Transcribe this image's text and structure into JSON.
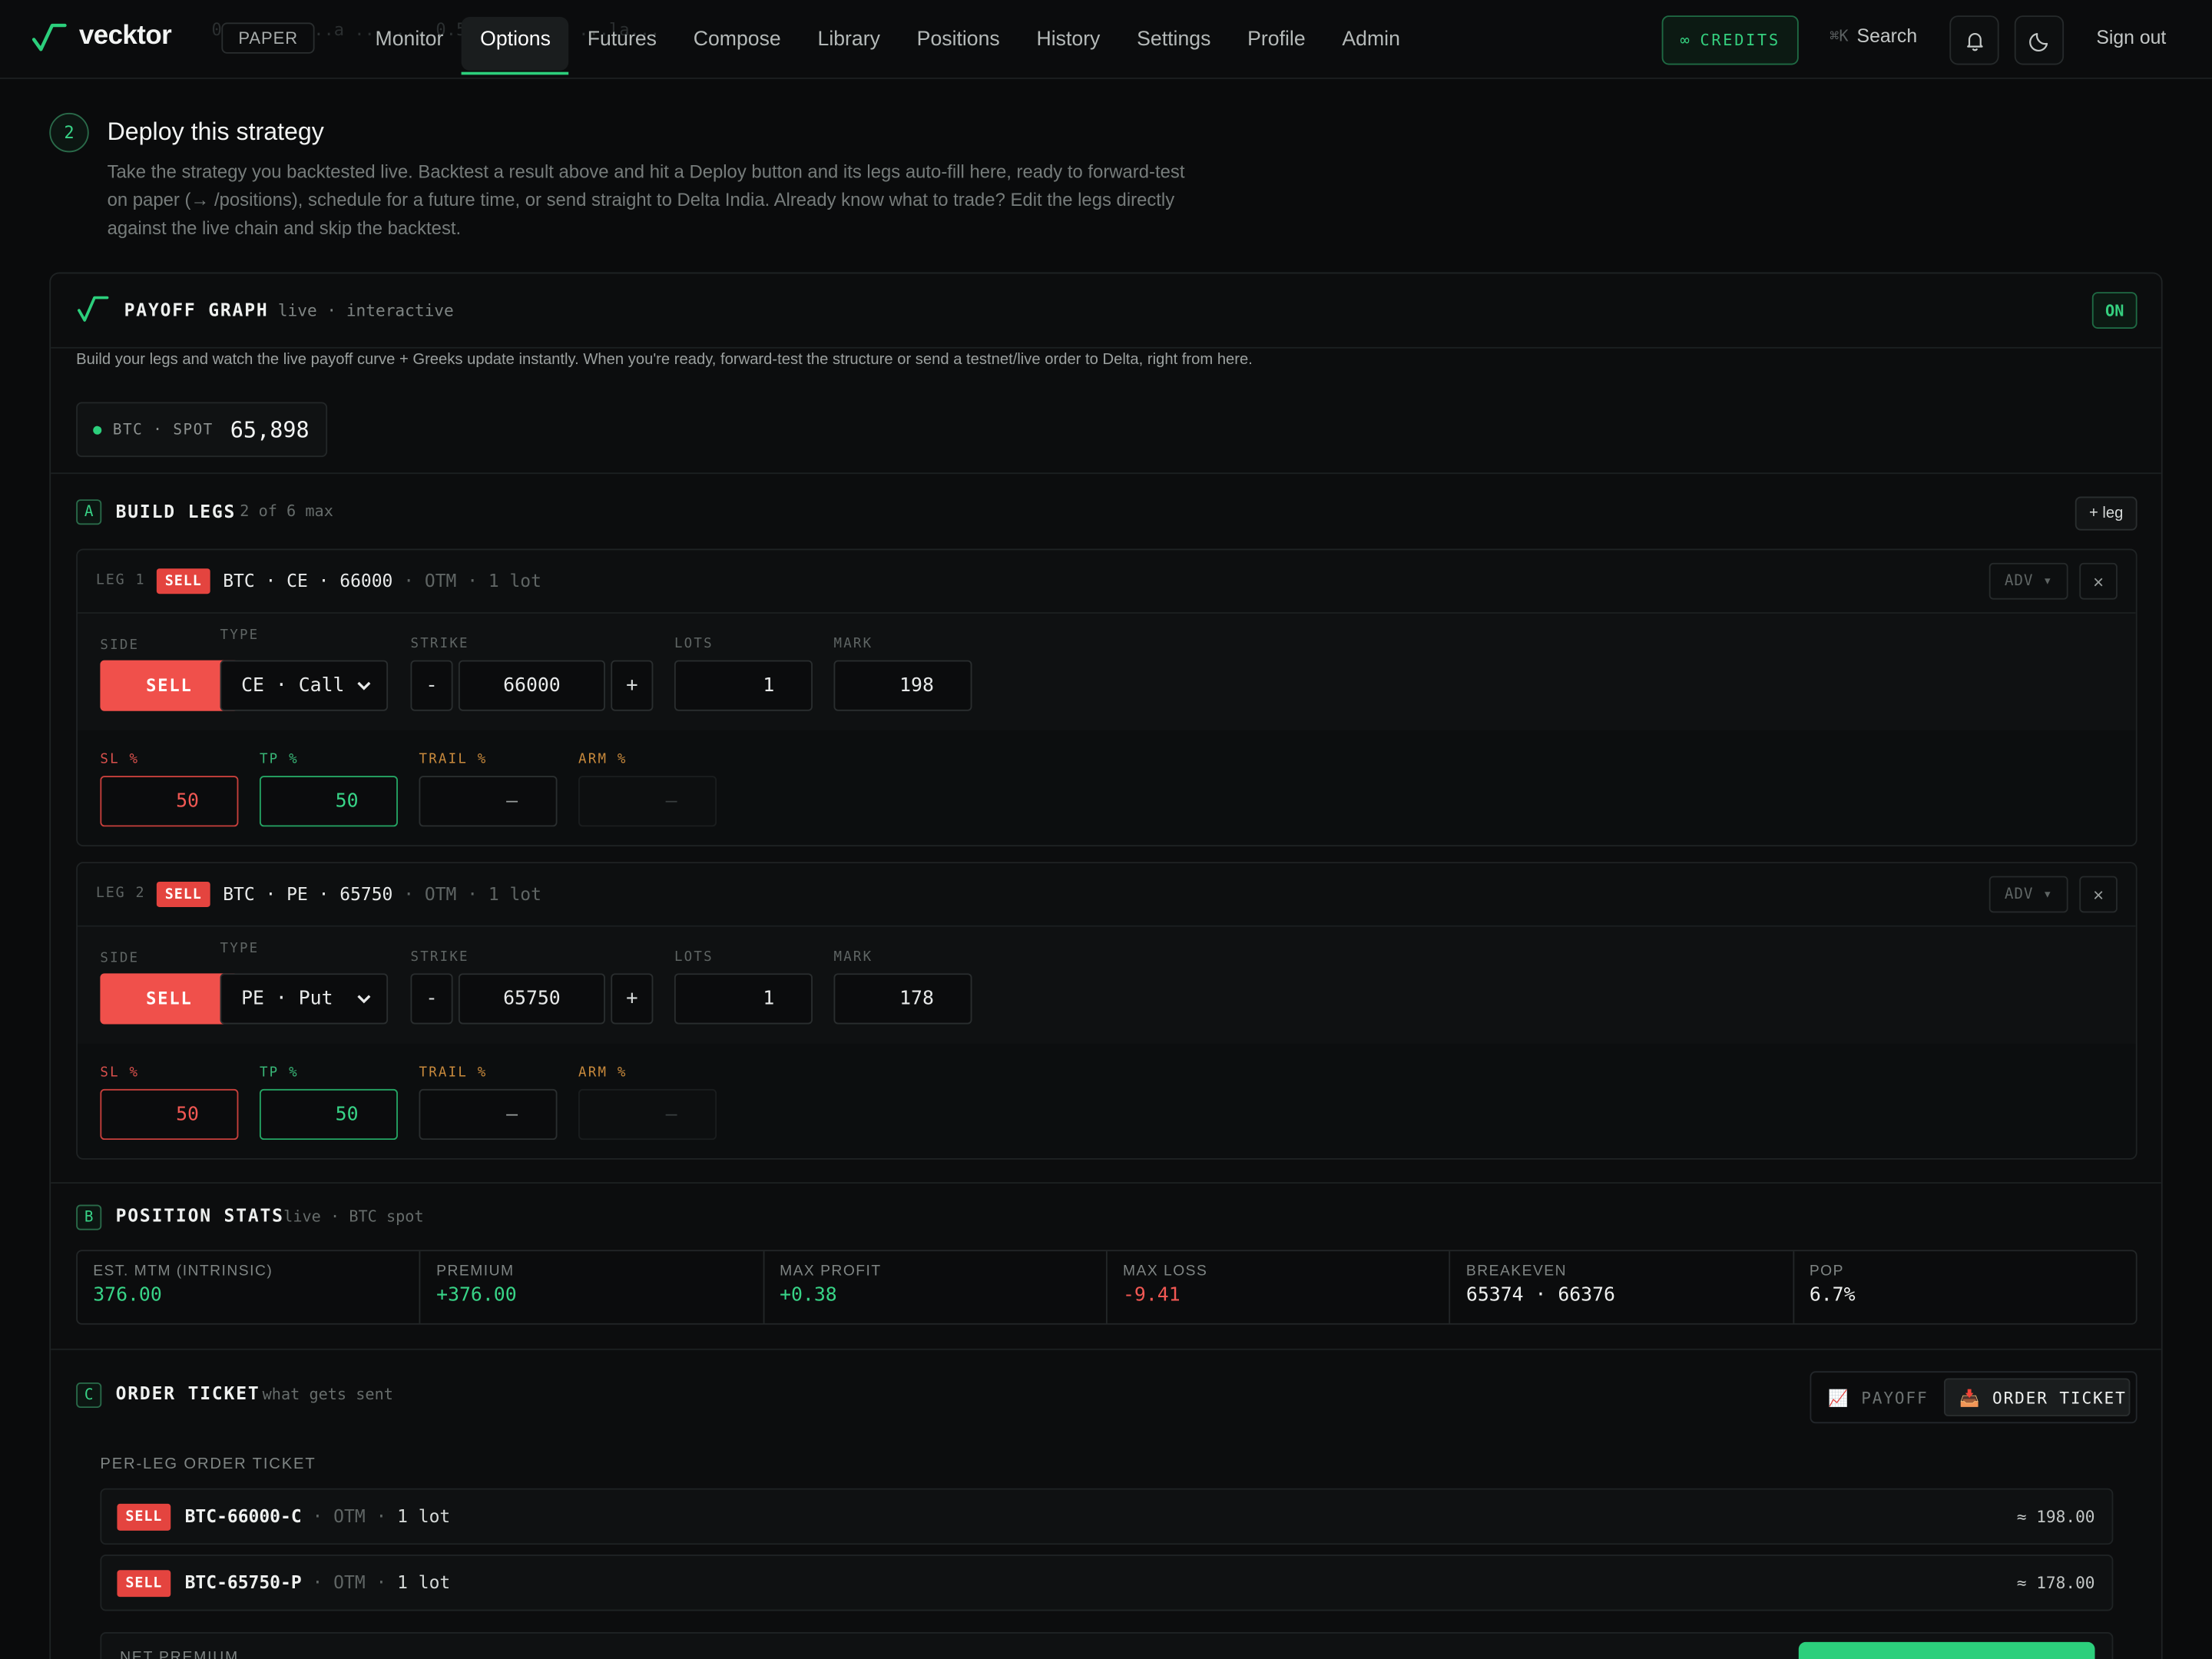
{
  "app": {
    "name": "vecktor",
    "mode_badge": "PAPER",
    "ghost_text": "0  exp... ...a ... ... 0.5 ... st... ...la..."
  },
  "nav": {
    "items": [
      "Monitor",
      "Options",
      "Futures",
      "Compose",
      "Library",
      "Positions",
      "History",
      "Settings",
      "Profile",
      "Admin"
    ],
    "active": "Options"
  },
  "header": {
    "credits_label": "CREDITS",
    "credits_icon": "∞",
    "search_shortcut": "⌘K",
    "search_label": "Search",
    "signout_label": "Sign out"
  },
  "section": {
    "step": "2",
    "title": "Deploy this strategy",
    "description": "Take the strategy you backtested live. Backtest a result above and hit a Deploy button and its legs auto-fill here, ready to forward-test on paper (→ /positions), schedule for a future time, or send straight to Delta India. Already know what to trade? Edit the legs directly against the live chain and skip the backtest."
  },
  "payoff": {
    "title": "PAYOFF GRAPH",
    "subtitle": "live · interactive",
    "toggle": "ON",
    "description": "Build your legs and watch the live payoff curve + Greeks update instantly. When you're ready, forward-test the structure or send a testnet/live order to Delta, right from here.",
    "spot_label": "BTC · SPOT",
    "spot_value": "65,898"
  },
  "build": {
    "letter": "A",
    "title": "BUILD LEGS",
    "subtitle": "2 of 6 max",
    "add_label": "+ leg",
    "labels": {
      "side": "SIDE",
      "type": "TYPE",
      "strike": "STRIKE",
      "lots": "LOTS",
      "mark": "MARK",
      "sl": "SL %",
      "tp": "TP %",
      "trail": "TRAIL %",
      "arm": "ARM %",
      "adv": "ADV ▾",
      "close": "×",
      "minus": "-",
      "plus": "+"
    },
    "legs": [
      {
        "num": "LEG 1",
        "tag": "SELL",
        "asset": "BTC",
        "opt": "CE",
        "strike_sum": "66000",
        "moneyness": "OTM",
        "lots_sum": "1 lot",
        "side": "SELL",
        "type": "CE · Call",
        "strike": "66000",
        "lots": "1",
        "mark": "198",
        "sl": "50",
        "tp": "50",
        "trail": "—",
        "arm": "—"
      },
      {
        "num": "LEG 2",
        "tag": "SELL",
        "asset": "BTC",
        "opt": "PE",
        "strike_sum": "65750",
        "moneyness": "OTM",
        "lots_sum": "1 lot",
        "side": "SELL",
        "type": "PE · Put",
        "strike": "65750",
        "lots": "1",
        "mark": "178",
        "sl": "50",
        "tp": "50",
        "trail": "—",
        "arm": "—"
      }
    ]
  },
  "stats": {
    "letter": "B",
    "title": "POSITION STATS",
    "subtitle": "live · BTC spot",
    "items": [
      {
        "label": "EST. MTM (INTRINSIC)",
        "value": "376.00",
        "color": "#38d487"
      },
      {
        "label": "PREMIUM",
        "value": "+376.00",
        "color": "#38d487"
      },
      {
        "label": "MAX PROFIT",
        "value": "+0.38",
        "color": "#38d487"
      },
      {
        "label": "MAX LOSS",
        "value": "-9.41",
        "color": "#f15853"
      },
      {
        "label": "BREAKEVEN",
        "value": "65374 · 66376",
        "color": "#eef0ef"
      },
      {
        "label": "POP",
        "value": "6.7%",
        "color": "#eef0ef"
      }
    ]
  },
  "ticket": {
    "letter": "C",
    "title": "ORDER TICKET",
    "subtitle": "what gets sent",
    "tab_payoff": "PAYOFF",
    "tab_payoff_icon": "📈",
    "tab_ticket": "ORDER TICKET",
    "tab_ticket_icon": "📥",
    "per_leg_label": "PER-LEG ORDER TICKET",
    "rows": [
      {
        "tag": "SELL",
        "symbol": "BTC-66000-C",
        "moneyness": "OTM",
        "lots": "1 lot",
        "amount": "≈ 198.00"
      },
      {
        "tag": "SELL",
        "symbol": "BTC-65750-P",
        "moneyness": "OTM",
        "lots": "1 lot",
        "amount": "≈ 178.00"
      }
    ],
    "net_label": "NET PREMIUM"
  },
  "colors": {
    "accent": "#2ccf7c",
    "sell": "#f0504b",
    "background": "#0a0b0c"
  }
}
